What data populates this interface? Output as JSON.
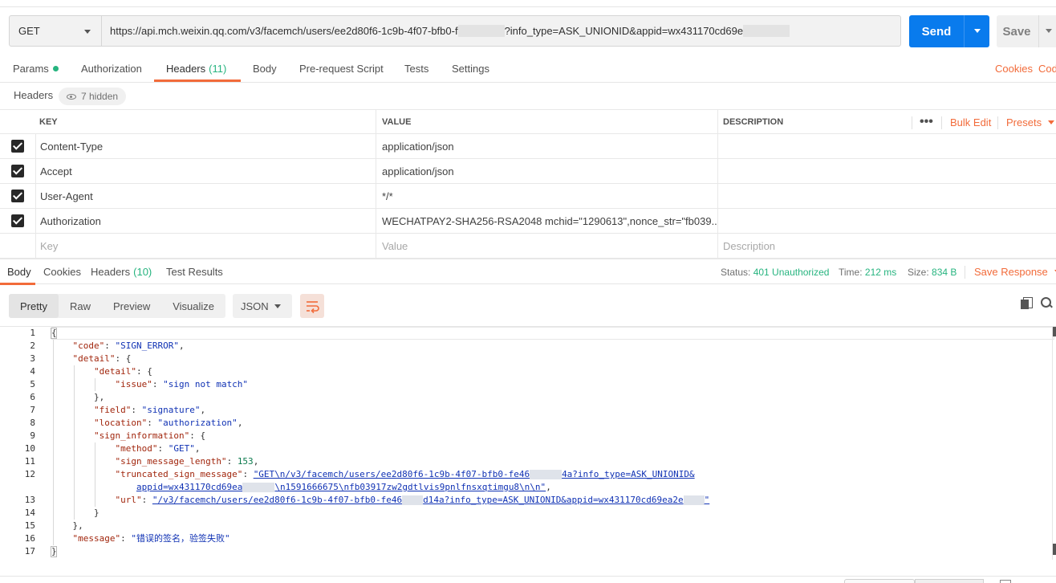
{
  "request": {
    "method": "GET",
    "url_prefix": "https://api.mch.weixin.qq.com/v3/facemch/users/ee2d80f6-1c9b-4f07-bfb0-f",
    "url_mid": "?info_type=ASK_UNIONID&appid=wx431170cd69e",
    "send_label": "Send",
    "save_label": "Save"
  },
  "request_tabs": [
    {
      "label": "Params",
      "dot": true
    },
    {
      "label": "Authorization"
    },
    {
      "label": "Headers",
      "count": "(11)",
      "active": true
    },
    {
      "label": "Body"
    },
    {
      "label": "Pre-request Script"
    },
    {
      "label": "Tests"
    },
    {
      "label": "Settings"
    }
  ],
  "request_links": {
    "cookies": "Cookies",
    "code": "Code"
  },
  "headers_section": {
    "title": "Headers",
    "hidden_label": "7 hidden"
  },
  "headers_table": {
    "columns": {
      "key": "KEY",
      "value": "VALUE",
      "description": "DESCRIPTION"
    },
    "bulk_edit": "Bulk Edit",
    "presets": "Presets",
    "rows": [
      {
        "key": "Content-Type",
        "value": "application/json",
        "checked": true
      },
      {
        "key": "Accept",
        "value": "application/json",
        "checked": true
      },
      {
        "key": "User-Agent",
        "value": "*/*",
        "checked": true
      },
      {
        "key": "Authorization",
        "value": "WECHATPAY2-SHA256-RSA2048 mchid=\"1290613",
        "value_tail": "\",nonce_str=\"fb039...",
        "checked": true
      }
    ],
    "placeholders": {
      "key": "Key",
      "value": "Value",
      "description": "Description"
    }
  },
  "response_tabs": [
    {
      "label": "Body",
      "active": true
    },
    {
      "label": "Cookies"
    },
    {
      "label": "Headers",
      "count": "(10)"
    },
    {
      "label": "Test Results"
    }
  ],
  "response_status": {
    "status_label": "Status:",
    "status_value": "401 Unauthorized",
    "time_label": "Time:",
    "time_value": "212 ms",
    "size_label": "Size:",
    "size_value": "834 B",
    "save_response": "Save Response"
  },
  "response_view": {
    "modes": [
      "Pretty",
      "Raw",
      "Preview",
      "Visualize"
    ],
    "active_mode": "Pretty",
    "format": "JSON"
  },
  "code": {
    "line_numbers": [
      "1",
      "2",
      "3",
      "4",
      "5",
      "6",
      "7",
      "8",
      "9",
      "10",
      "11",
      "12",
      "",
      "13",
      "14",
      "15",
      "16",
      "17"
    ],
    "l2_key": "\"code\"",
    "l2_val": "\"SIGN_ERROR\"",
    "l3_key": "\"detail\"",
    "l4_key": "\"detail\"",
    "l5_key": "\"issue\"",
    "l5_val": "\"sign not match\"",
    "l7_key": "\"field\"",
    "l7_val": "\"signature\"",
    "l8_key": "\"location\"",
    "l8_val": "\"authorization\"",
    "l9_key": "\"sign_information\"",
    "l10_key": "\"method\"",
    "l10_val": "\"GET\"",
    "l11_key": "\"sign_message_length\"",
    "l11_val": "153",
    "l12_key": "\"truncated_sign_message\"",
    "l12_val_a": "\"GET\\n/v3/facemch/users/ee2d80f6-1c9b-4f07-bfb0-fe46",
    "l12_val_b": "4a?info_type=ASK_UNIONID&",
    "l12b_val_a": "appid=wx431170cd69ea",
    "l12b_val_b": "\\n1591666675\\nfb03917zw2gdtlvis9pnlfnsxqtimgu8\\n\\n\"",
    "l13_key": "\"url\"",
    "l13_val_a": "\"/v3/facemch/users/ee2d80f6-1c9b-4f07-bfb0-fe46",
    "l13_val_b": "d14a?info_type=ASK_UNIONID&appid=wx431170cd69ea2e",
    "l13_val_c": "\"",
    "l16_key": "\"message\"",
    "l16_val": "\"错误的签名，验签失败\""
  }
}
